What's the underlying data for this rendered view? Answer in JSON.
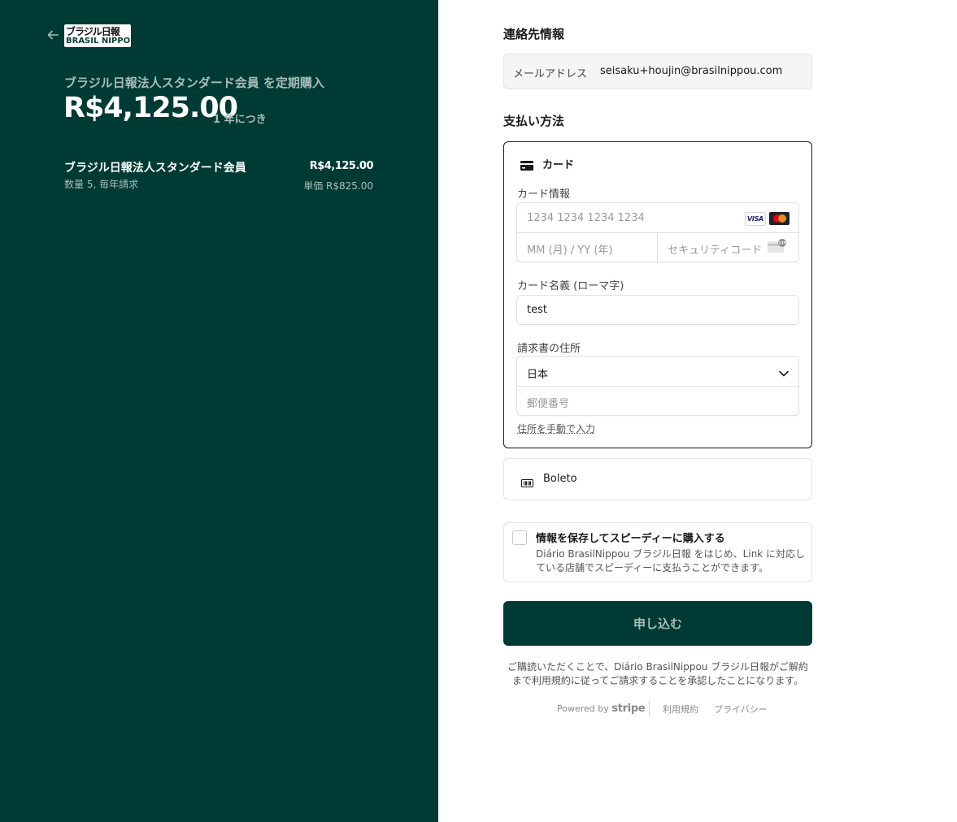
{
  "summary": {
    "logo_line1": "ブラジル日報",
    "logo_line2": "BRASIL NIPPOU",
    "subscribe_title": "ブラジル日報法人スタンダード会員 を定期購入",
    "price": "R$4,125.00",
    "period": "1 年につき",
    "item": {
      "name": "ブラジル日報法人スタンダード会員",
      "detail": "数量 5, 毎年請求",
      "amount": "R$4,125.00",
      "unit_price": "単価 R$825.00"
    }
  },
  "contact": {
    "heading": "連絡先情報",
    "email_label": "メールアドレス",
    "email_value": "seisaku+houjin@brasilnippou.com"
  },
  "payment": {
    "heading": "支払い方法",
    "card": {
      "title": "カード",
      "info_label": "カード情報",
      "number_placeholder": "1234 1234 1234 1234",
      "brand_visa": "VISA",
      "expiry_placeholder": "MM (月) / YY (年)",
      "cvc_placeholder": "セキュリティコード",
      "cvc_badge": "135",
      "name_label": "カード名義 (ローマ字)",
      "name_value": "test",
      "address_label": "請求書の住所",
      "country_value": "日本",
      "postal_placeholder": "郵便番号",
      "manual_address": "住所を手動で入力"
    },
    "boleto_label": "Boleto"
  },
  "link": {
    "title": "情報を保存してスピーディーに購入する",
    "description": "Diário BrasilNippou ブラジル日報 をはじめ、Link に対応している店舗でスピーディーに支払うことができます。"
  },
  "submit_label": "申し込む",
  "terms_text": "ご購読いただくことで、Diário BrasilNippou ブラジル日報がご解約まで利用規約に従ってご請求することを承認したことになります。",
  "footer": {
    "powered_by": "Powered by",
    "stripe": "stripe",
    "terms_link": "利用規約",
    "privacy_link": "プライバシー"
  },
  "colors": {
    "brand_dark_green": "#003a34",
    "muted_green_text": "#a7bdb9"
  }
}
